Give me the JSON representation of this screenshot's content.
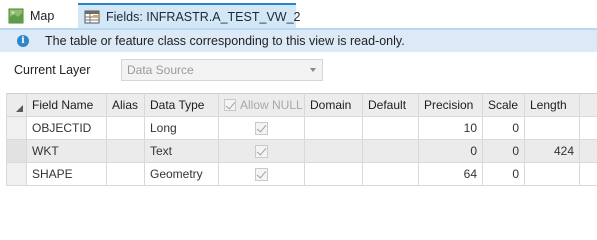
{
  "tabs": {
    "map_label": "Map",
    "fields_label": "Fields:  INFRASTR.A_TEST_VW_2"
  },
  "info": {
    "message": "The table or feature class corresponding to this view is read-only."
  },
  "layer": {
    "label": "Current Layer",
    "selected": "Data Source"
  },
  "grid": {
    "headers": {
      "field_name": "Field Name",
      "alias": "Alias",
      "data_type": "Data Type",
      "allow_null": "Allow NULL",
      "domain": "Domain",
      "default": "Default",
      "precision": "Precision",
      "scale": "Scale",
      "length": "Length"
    },
    "rows": [
      {
        "field_name": "OBJECTID",
        "alias": "",
        "data_type": "Long",
        "allow_null": true,
        "domain": "",
        "default": "",
        "precision": "10",
        "scale": "0",
        "length": ""
      },
      {
        "field_name": "WKT",
        "alias": "",
        "data_type": "Text",
        "allow_null": true,
        "domain": "",
        "default": "",
        "precision": "0",
        "scale": "0",
        "length": "424"
      },
      {
        "field_name": "SHAPE",
        "alias": "",
        "data_type": "Geometry",
        "allow_null": true,
        "domain": "",
        "default": "",
        "precision": "64",
        "scale": "0",
        "length": ""
      }
    ]
  },
  "colors": {
    "tab_active_bg": "#d3e8f6",
    "tab_active_border": "#2a83c6",
    "info_bg": "#dbeaf6",
    "info_icon": "#2f86c8"
  },
  "icons": {
    "map_tab": "map-icon",
    "fields_tab": "fields-table-icon",
    "close": "close-icon",
    "info": "info-icon"
  }
}
